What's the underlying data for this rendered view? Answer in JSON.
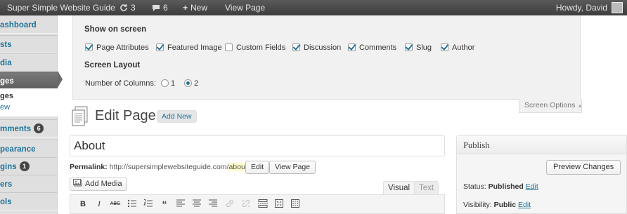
{
  "admin_bar": {
    "site_name": "Super Simple Website Guide",
    "updates_count": "3",
    "comments_count": "6",
    "new_label": "New",
    "view_page_label": "View Page",
    "greeting": "Howdy, David"
  },
  "sidebar": {
    "items": [
      {
        "label": "ashboard"
      },
      {
        "label": "sts"
      },
      {
        "label": "dia"
      },
      {
        "label": "ges"
      },
      {
        "label": "mments",
        "badge": "6"
      },
      {
        "label": "pearance"
      },
      {
        "label": "gins",
        "badge": "1"
      },
      {
        "label": "ers"
      },
      {
        "label": "ols"
      }
    ],
    "submenu": [
      "ges",
      "ew"
    ]
  },
  "screen_options": {
    "show_on_screen_heading": "Show on screen",
    "checkboxes": [
      {
        "label": "Page Attributes",
        "checked": true
      },
      {
        "label": "Featured Image",
        "checked": true
      },
      {
        "label": "Custom Fields",
        "checked": false
      },
      {
        "label": "Discussion",
        "checked": true
      },
      {
        "label": "Comments",
        "checked": true
      },
      {
        "label": "Slug",
        "checked": true
      },
      {
        "label": "Author",
        "checked": true
      }
    ],
    "layout_heading": "Screen Layout",
    "columns_label": "Number of Columns:",
    "column_options": [
      "1",
      "2"
    ],
    "selected_columns": "2",
    "tab_label": "Screen Options"
  },
  "page_header": {
    "title": "Edit Page",
    "add_new_label": "Add New"
  },
  "editor": {
    "post_title": "About",
    "permalink_label": "Permalink:",
    "permalink_base": "http://supersimplewebsiteguide.com/",
    "permalink_slug": "about",
    "permalink_end": "/",
    "edit_button": "Edit",
    "view_page_button": "View Page",
    "add_media_label": "Add Media",
    "tab_visual": "Visual",
    "tab_text": "Text",
    "toolbar": [
      "B",
      "I",
      "ABC",
      "ul",
      "ol",
      "quote",
      "align-left",
      "align-center",
      "align-right",
      "link",
      "unlink",
      "more",
      "fullscreen",
      "kitchen-sink"
    ]
  },
  "publish_box": {
    "heading": "Publish",
    "preview_button": "Preview Changes",
    "status_label": "Status:",
    "status_value": "Published",
    "visibility_label": "Visibility:",
    "visibility_value": "Public",
    "edit_link": "Edit"
  },
  "colors": {
    "admin_bar": "#464646",
    "link": "#21759b",
    "current_menu": "#6a6a6a"
  }
}
